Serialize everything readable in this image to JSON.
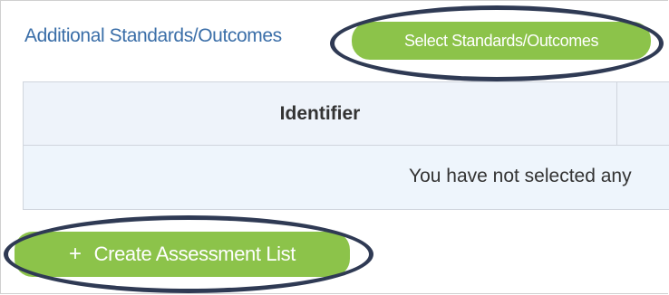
{
  "section": {
    "label": "Additional Standards/Outcomes",
    "select_button": "Select Standards/Outcomes"
  },
  "table": {
    "headers": [
      "Identifier"
    ],
    "empty_message": "You have not selected any"
  },
  "actions": {
    "create_plus": "+",
    "create_label": "Create Assessment List"
  },
  "colors": {
    "accent_green": "#8cc34a",
    "link_blue": "#3a6ea8",
    "highlight_ring": "#2f3a54",
    "table_header_bg": "#eef3fa"
  }
}
